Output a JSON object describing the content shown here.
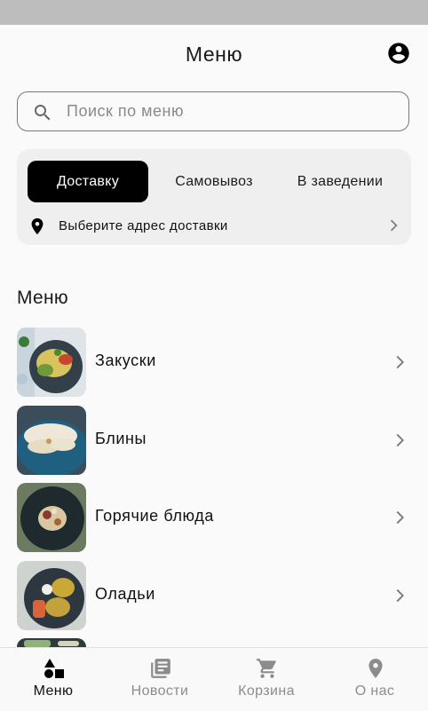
{
  "header": {
    "title": "Меню",
    "profile_icon": "account-circle-icon"
  },
  "search": {
    "placeholder": "Поиск по меню",
    "icon": "search-icon"
  },
  "order_modes": {
    "tabs": [
      {
        "label": "Доставку",
        "active": true
      },
      {
        "label": "Самовывоз",
        "active": false
      },
      {
        "label": "В заведении",
        "active": false
      }
    ],
    "address": {
      "label": "Выберите адрес доставки",
      "icon": "location-pin-icon"
    }
  },
  "menu": {
    "title": "Меню",
    "items": [
      {
        "label": "Закуски"
      },
      {
        "label": "Блины"
      },
      {
        "label": "Горячие блюда"
      },
      {
        "label": "Оладьи"
      }
    ]
  },
  "bottom_nav": {
    "items": [
      {
        "label": "Меню",
        "icon": "shapes-icon",
        "active": true
      },
      {
        "label": "Новости",
        "icon": "newspaper-icon",
        "active": false
      },
      {
        "label": "Корзина",
        "icon": "shopping-cart-icon",
        "active": false
      },
      {
        "label": "О нас",
        "icon": "location-pin-icon",
        "active": false
      }
    ]
  },
  "colors": {
    "accent": "#000000",
    "background": "#fafafa",
    "card": "#efefef",
    "status_bar": "#bdbdbd",
    "inactive": "#8c8c8c"
  }
}
